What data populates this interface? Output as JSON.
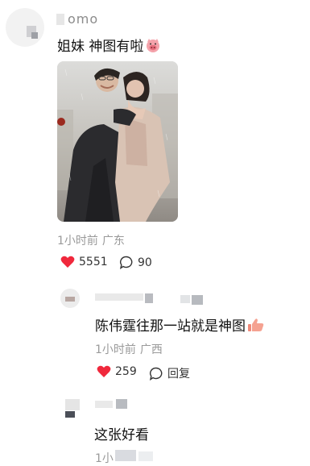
{
  "post": {
    "author_name": "omo",
    "text": "姐妹 神图有啦",
    "emoji_icon": "pig-face-icon",
    "time": "1小时前",
    "location": "广东",
    "likes": "5551",
    "comments": "90"
  },
  "replies": [
    {
      "text": "陈伟霆往那一站就是神图",
      "emoji_icon": "thumbs-up-icon",
      "time": "1小时前",
      "location": "广西",
      "likes": "259",
      "reply_label": "回复"
    },
    {
      "text": "这张好看",
      "time": "1小"
    }
  ],
  "colors": {
    "like": "#f0283c",
    "meta": "#9a9a9a",
    "text": "#111111"
  }
}
